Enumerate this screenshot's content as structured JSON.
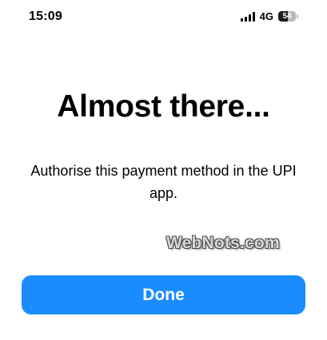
{
  "status_bar": {
    "time": "15:09",
    "network": "4G",
    "battery_level": "54",
    "battery_fraction": 0.54,
    "signal_icon": "cellular-signal-icon",
    "battery_icon": "battery-icon"
  },
  "sheet": {
    "title": "Almost there...",
    "message": "Authorise this payment method in the UPI app.",
    "done_label": "Done"
  },
  "watermark": {
    "text": "WebNots.com"
  },
  "colors": {
    "accent": "#1a8cff",
    "background": "#ffffff",
    "text": "#000000"
  }
}
